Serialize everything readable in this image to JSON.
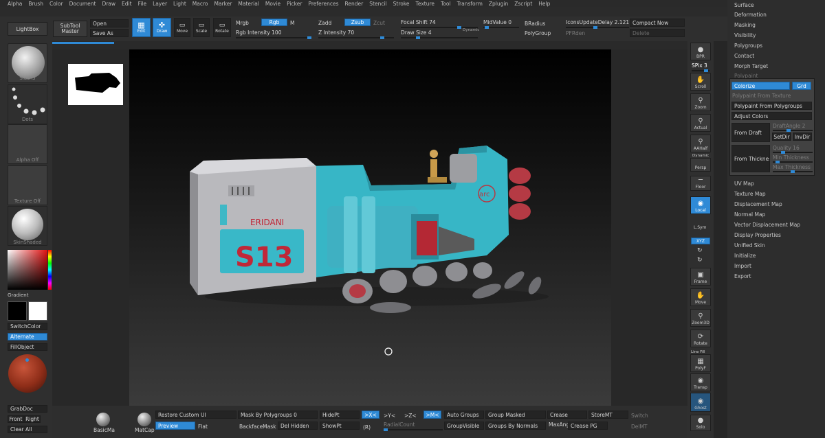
{
  "menu": [
    "Alpha",
    "Brush",
    "Color",
    "Document",
    "Draw",
    "Edit",
    "File",
    "Layer",
    "Light",
    "Macro",
    "Marker",
    "Material",
    "Movie",
    "Picker",
    "Preferences",
    "Render",
    "Stencil",
    "Stroke",
    "Texture",
    "Tool",
    "Transform",
    "Zplugin",
    "Zscript",
    "Help"
  ],
  "top": {
    "lightbox": "LightBox",
    "subtool_master": "SubTool\nMaster",
    "open": "Open",
    "save_as": "Save As",
    "edit": "Edit",
    "draw": "Draw",
    "move": "Move",
    "scale": "Scale",
    "rotate": "Rotate",
    "mrgb": "Mrgb",
    "rgb": "Rgb",
    "m": "M",
    "rgb_intensity": "Rgb Intensity 100",
    "zadd": "Zadd",
    "zsub": "Zsub",
    "zcut": "Zcut",
    "z_intensity": "Z Intensity 70",
    "focal_shift": "Focal Shift 74",
    "draw_size": "Draw Size 4",
    "dynamic": "Dynamic",
    "mid_value": "MidValue 0",
    "bradius": "BRadius",
    "polygroup": "PolyGroup",
    "icons_update_delay": "IconsUpdateDelay 2.12113",
    "compact_now": "Compact Now",
    "delete": "Delete",
    "prefill": "PFRden"
  },
  "left": {
    "brush": "Slash3",
    "stroke": "Dots",
    "alpha": "Alpha Off",
    "texture": "Texture Off",
    "material": "SkinShaded",
    "gradient": "Gradient",
    "switch_color": "SwitchColor",
    "alternate": "Alternate",
    "fill_object": "FillObject",
    "grab_doc": "GrabDoc",
    "front": "Front",
    "right": "Right",
    "clear_all": "Clear All"
  },
  "model": {
    "name": "ERIDANI",
    "code": "S13",
    "logo": "arc"
  },
  "right": {
    "bpr": "BPR",
    "spix": "SPix 3",
    "scroll": "Scroll",
    "zoom": "Zoom",
    "actual": "Actual",
    "aahalf": "AAHalf",
    "dynamic": "Dynamic",
    "persp": "Persp",
    "floor": "Floor",
    "local": "Local",
    "lsym": "L.Sym",
    "xyz": "XYZ",
    "frame": "Frame",
    "move": "Move",
    "zoom3d": "Zoom3D",
    "rotate": "Rotate",
    "line_fill": "Line Fill",
    "polyf": "PolyF",
    "transp": "Transp",
    "ghost": "Ghost",
    "solo": "Solo"
  },
  "palette": {
    "items_top": [
      "Surface",
      "Deformation",
      "Masking",
      "Visibility",
      "Polygroups",
      "Contact",
      "Morph Target",
      "Polypaint"
    ],
    "colorize": "Colorize",
    "grd": "Grd",
    "poly_from_tex": "Polypaint From Texture",
    "poly_from_pg": "Polypaint From Polygroups",
    "adjust_colors": "Adjust Colors",
    "from_draft": "From Draft",
    "draft_angle": "DraftAngle 2",
    "set_dir": "SetDir",
    "inv_dir": "InvDir",
    "from_thickness": "From Thickness",
    "quality": "Quality 16",
    "min_thickness": "Min Thickness",
    "max_thickness": "Max Thickness",
    "items_bottom": [
      "UV Map",
      "Texture Map",
      "Displacement Map",
      "Normal Map",
      "Vector Displacement Map",
      "Display Properties",
      "Unified Skin",
      "Initialize",
      "Import",
      "Export"
    ]
  },
  "bottom": {
    "basic_mat": "BasicMa",
    "matcap": "MatCap",
    "restore_custom_ui": "Restore Custom UI",
    "preview": "Preview",
    "flat": "Flat",
    "mask_by_polygroups": "Mask By Polygroups 0",
    "backface_mask": "BackfaceMask",
    "del_hidden": "Del Hidden",
    "hidept": "HidePt",
    "showpt": "ShowPt",
    "x_sym": ">X<",
    "y_sym": ">Y<",
    "z_sym": ">Z<",
    "m_sym": ">M<",
    "r": "(R)",
    "radial_count": "RadialCount",
    "auto_groups": "Auto Groups",
    "group_visible": "GroupVisible",
    "group_masked": "Group Masked",
    "groups_by_normals": "Groups By Normals",
    "crease": "Crease",
    "maxang": "MaxAng",
    "crease_pg": "Crease PG",
    "store_mt": "StoreMT",
    "del_mt": "DelMT",
    "switch": "Switch"
  }
}
